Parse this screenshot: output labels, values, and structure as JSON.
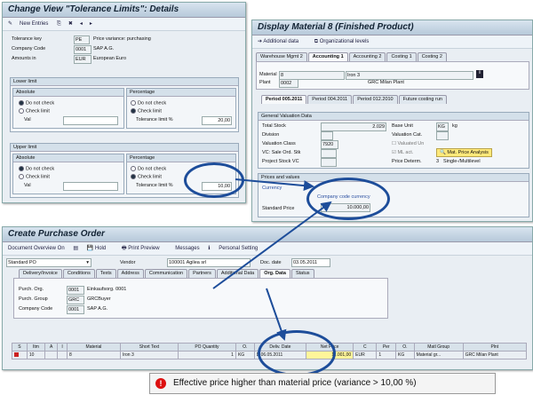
{
  "tolerance_window": {
    "title": "Change View \"Tolerance Limits\": Details",
    "new_entries": "New Entries",
    "fields": [
      {
        "label": "Tolerance key",
        "value": "PE",
        "desc": "Price variance: purchasing"
      },
      {
        "label": "Company Code",
        "value": "0001",
        "desc": "SAP A.G."
      },
      {
        "label": "Amounts in",
        "value": "EUR",
        "desc": "European Euro"
      }
    ],
    "lower": {
      "title": "Lower limit",
      "absolute": "Absolute",
      "do_not_check": "Do not check",
      "check_limit": "Check limit",
      "val": "Val",
      "percentage": "Percentage",
      "tol_label": "Tolerance limit %",
      "tol_value": "20,00"
    },
    "upper": {
      "title": "Upper limit",
      "absolute": "Absolute",
      "do_not_check": "Do not check",
      "check_limit": "Check limit",
      "val": "Val",
      "percentage": "Percentage",
      "tol_label": "Tolerance limit %",
      "tol_value": "10,00"
    }
  },
  "material_window": {
    "title": "Display Material 8 (Finished Product)",
    "additional_data": "Additional data",
    "org_levels": "Organizational levels",
    "tabs": [
      "Warehouse Mgmt 2",
      "Accounting 1",
      "Accounting 2",
      "Costing 1",
      "Costing 2"
    ],
    "material_label": "Material",
    "material_value": "8",
    "material_desc": "Iron 3",
    "plant_label": "Plant",
    "plant_value": "0002",
    "plant_desc": "GRC Milan Plant",
    "period_tabs": [
      "Period 005.2011",
      "Period 004.2011",
      "Period 012.2010",
      "Future costing run"
    ],
    "gvd_title": "General Valuation Data",
    "total_stock_label": "Total Stock",
    "total_stock_value": "2.029",
    "base_unit_label": "Base Unit",
    "base_unit_value": "KG",
    "base_unit_desc": "kg",
    "division_label": "Division",
    "valuation_cat_label": "Valuation Cat.",
    "valuation_class_label": "Valuation Class",
    "valuation_class_value": "7920",
    "valuated_un_label": "Valuated Un",
    "vc_sales_label": "VC: Sale Ord. Stk",
    "ml_act_label": "ML act.",
    "mat_price_analysis": "Mat. Price Analysis",
    "project_stock_label": "Project Stock VC",
    "price_determ_label": "Price Determ.",
    "price_determ_value": "3",
    "price_determ_desc": "Single-/Multilevel",
    "prices_title": "Prices and values",
    "currency_label": "Currency",
    "company_code_currency": "Company code currency",
    "standard_price_label": "Standard Price",
    "standard_price_value": "10.000,00"
  },
  "po_window": {
    "title": "Create Purchase Order",
    "toolbar": [
      "Document Overview On",
      "Hold",
      "Print Preview",
      "Messages",
      "Personal Setting"
    ],
    "doc_type": "Standard PO",
    "vendor_label": "Vendor",
    "vendor_value": "100001 Agilea srl",
    "doc_date_label": "Doc. date",
    "doc_date_value": "03.05.2011",
    "tabs": [
      "Delivery/Invoice",
      "Conditions",
      "Texts",
      "Address",
      "Communication",
      "Partners",
      "Additional Data",
      "Org. Data",
      "Status"
    ],
    "org_rows": [
      {
        "label": "Purch. Org.",
        "value": "0001",
        "desc": "Einkaufsorg. 0001"
      },
      {
        "label": "Purch. Group",
        "value": "GRC",
        "desc": "GRCBuyer"
      },
      {
        "label": "Company Code",
        "value": "0001",
        "desc": "SAP A.G."
      }
    ],
    "grid_headers": [
      "S",
      "Itm",
      "A",
      "I",
      "Material",
      "Short Text",
      "PO Quantity",
      "O.",
      "Deliv. Date",
      "Net Price",
      "C",
      "Per",
      "O.",
      "Matl Group",
      "Plnt"
    ],
    "grid_row": [
      "",
      "10",
      "",
      "",
      "8",
      "Iron 3",
      "1",
      "KG",
      "D 06.05.2011",
      "11.001,00",
      "EUR",
      "1",
      "KG",
      "Material gr...",
      "GRC Milan Plant"
    ]
  },
  "error_message": "Effective price higher than material price (variance > 10,00 %)",
  "colors": {
    "error": "#dd1111",
    "circle": "#1d4d9a",
    "highlight": "#fff59a"
  }
}
